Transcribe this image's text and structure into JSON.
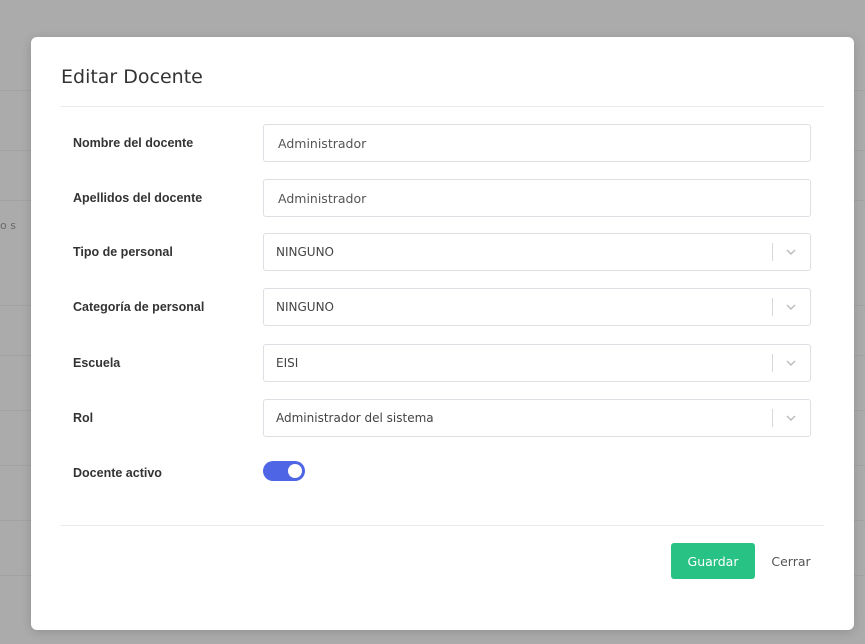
{
  "background": {
    "snippet_text": "o s"
  },
  "modal": {
    "title": "Editar Docente",
    "fields": {
      "nombre": {
        "label": "Nombre del docente",
        "value": "Administrador"
      },
      "apellidos": {
        "label": "Apellidos del docente",
        "value": "Administrador"
      },
      "tipo": {
        "label": "Tipo de personal",
        "value": "NINGUNO"
      },
      "categoria": {
        "label": "Categoría de personal",
        "value": "NINGUNO"
      },
      "escuela": {
        "label": "Escuela",
        "value": "EISI"
      },
      "rol": {
        "label": "Rol",
        "value": "Administrador del sistema"
      },
      "activo": {
        "label": "Docente activo",
        "checked": true
      }
    },
    "buttons": {
      "save_label": "Guardar",
      "close_label": "Cerrar"
    }
  },
  "colors": {
    "accent_toggle": "#4e66e6",
    "save_button": "#28c384"
  },
  "icons": {
    "select_arrow": "chevron-down-icon"
  }
}
